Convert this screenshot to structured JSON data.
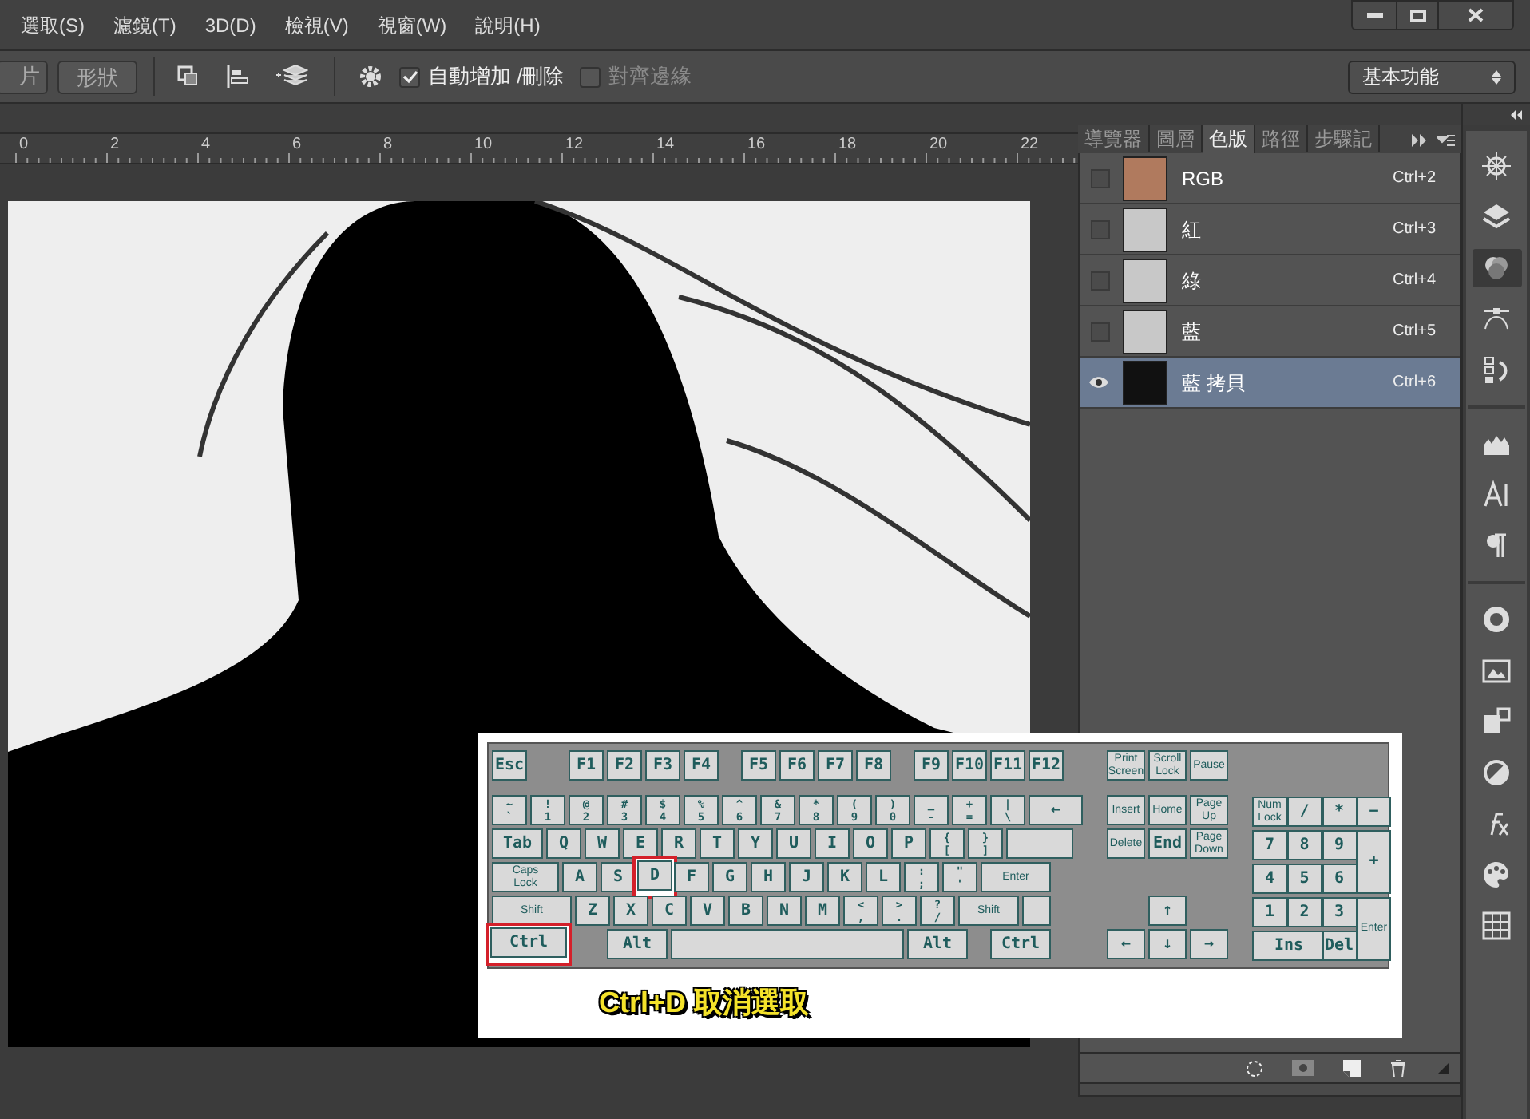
{
  "menu": [
    "選取(S)",
    "濾鏡(T)",
    "3D(D)",
    "檢視(V)",
    "視窗(W)",
    "說明(H)"
  ],
  "options_bar": {
    "buttons": [
      "片",
      "形狀"
    ],
    "auto_add_delete": {
      "label": "自動增加 /刪除",
      "checked": true
    },
    "snap_edges": {
      "label": "對齊邊緣",
      "checked": false,
      "disabled": true
    },
    "workspace": "基本功能"
  },
  "ruler": [
    "0",
    "2",
    "4",
    "6",
    "8",
    "10",
    "12",
    "14",
    "16",
    "18",
    "20",
    "22"
  ],
  "channels_panel": {
    "tabs": [
      {
        "label": "導覽器",
        "selected": false
      },
      {
        "label": "圖層",
        "selected": false
      },
      {
        "label": "色版",
        "selected": true
      },
      {
        "label": "路徑",
        "selected": false
      },
      {
        "label": "步驟記",
        "selected": false
      }
    ],
    "channels": [
      {
        "name": "RGB",
        "shortcut": "Ctrl+2",
        "visible": false,
        "selected": false,
        "kind": "color"
      },
      {
        "name": "紅",
        "shortcut": "Ctrl+3",
        "visible": false,
        "selected": false,
        "kind": "gray"
      },
      {
        "name": "綠",
        "shortcut": "Ctrl+4",
        "visible": false,
        "selected": false,
        "kind": "gray"
      },
      {
        "name": "藍",
        "shortcut": "Ctrl+5",
        "visible": false,
        "selected": false,
        "kind": "gray"
      },
      {
        "name": "藍 拷貝",
        "shortcut": "Ctrl+6",
        "visible": true,
        "selected": true,
        "kind": "mask"
      }
    ]
  },
  "dock": [
    {
      "selected": false
    },
    {
      "selected": false
    },
    {
      "selected": true
    },
    {
      "selected": false
    },
    {
      "selected": false
    },
    {
      "selected": false
    },
    {
      "selected": false
    },
    {
      "selected": false
    },
    {
      "selected": false
    },
    {
      "selected": false
    },
    {
      "selected": false
    },
    {
      "selected": false
    },
    {
      "selected": false
    },
    {
      "selected": false
    },
    {
      "selected": false
    }
  ],
  "keyboard_image": {
    "main_rows": [
      [
        {
          "label": "Esc",
          "kind": "key",
          "highlighted": false
        },
        {
          "kind": "gap"
        },
        {
          "label": "F1",
          "kind": "key",
          "highlighted": false
        },
        {
          "label": "F2",
          "kind": "key",
          "highlighted": false
        },
        {
          "label": "F3",
          "kind": "key",
          "highlighted": false
        },
        {
          "label": "F4",
          "kind": "key",
          "highlighted": false
        },
        {
          "kind": "split"
        },
        {
          "label": "F5",
          "kind": "key",
          "highlighted": false
        },
        {
          "label": "F6",
          "kind": "key",
          "highlighted": false
        },
        {
          "label": "F7",
          "kind": "key",
          "highlighted": false
        },
        {
          "label": "F8",
          "kind": "key",
          "highlighted": false
        },
        {
          "kind": "split"
        },
        {
          "label": "F9",
          "kind": "key",
          "highlighted": false
        },
        {
          "label": "F10",
          "kind": "key",
          "highlighted": false
        },
        {
          "label": "F11",
          "kind": "key",
          "highlighted": false
        },
        {
          "label": "F12",
          "kind": "key",
          "highlighted": false
        }
      ],
      [
        {
          "label": "~\n`",
          "kind": "key",
          "highlighted": false
        },
        {
          "label": "!\n1",
          "kind": "key",
          "highlighted": false
        },
        {
          "label": "@\n2",
          "kind": "key",
          "highlighted": false
        },
        {
          "label": "#\n3",
          "kind": "key",
          "highlighted": false
        },
        {
          "label": "$\n4",
          "kind": "key",
          "highlighted": false
        },
        {
          "label": "%\n5",
          "kind": "key",
          "highlighted": false
        },
        {
          "label": "^\n6",
          "kind": "key",
          "highlighted": false
        },
        {
          "label": "&\n7",
          "kind": "key",
          "highlighted": false
        },
        {
          "label": "*\n8",
          "kind": "key",
          "highlighted": false
        },
        {
          "label": "(\n9",
          "kind": "key",
          "highlighted": false
        },
        {
          "label": ")\n0",
          "kind": "key",
          "highlighted": false
        },
        {
          "label": "_\n-",
          "kind": "key",
          "highlighted": false
        },
        {
          "label": "+\n=",
          "kind": "key",
          "highlighted": false
        },
        {
          "label": "|\n\\",
          "kind": "key",
          "highlighted": false
        },
        {
          "label": "←",
          "kind": "back",
          "highlighted": false
        }
      ],
      [
        {
          "label": "Tab",
          "kind": "tab",
          "highlighted": false
        },
        {
          "label": "Q",
          "kind": "key",
          "highlighted": false
        },
        {
          "label": "W",
          "kind": "key",
          "highlighted": false
        },
        {
          "label": "E",
          "kind": "key",
          "highlighted": false
        },
        {
          "label": "R",
          "kind": "key",
          "highlighted": false
        },
        {
          "label": "T",
          "kind": "key",
          "highlighted": false
        },
        {
          "label": "Y",
          "kind": "key",
          "highlighted": false
        },
        {
          "label": "U",
          "kind": "key",
          "highlighted": false
        },
        {
          "label": "I",
          "kind": "key",
          "highlighted": false
        },
        {
          "label": "O",
          "kind": "key",
          "highlighted": false
        },
        {
          "label": "P",
          "kind": "key",
          "highlighted": false
        },
        {
          "label": "{\n[",
          "kind": "key",
          "highlighted": false
        },
        {
          "label": "}\n]",
          "kind": "key",
          "highlighted": false
        },
        {
          "kind": "entertop",
          "highlighted": false
        }
      ],
      [
        {
          "label": "Caps\nLock",
          "kind": "caps",
          "highlighted": false
        },
        {
          "label": "A",
          "kind": "key",
          "highlighted": false
        },
        {
          "label": "S",
          "kind": "key",
          "highlighted": false
        },
        {
          "label": "D",
          "kind": "key",
          "highlighted": true
        },
        {
          "label": "F",
          "kind": "key",
          "highlighted": false
        },
        {
          "label": "G",
          "kind": "key",
          "highlighted": false
        },
        {
          "label": "H",
          "kind": "key",
          "highlighted": false
        },
        {
          "label": "J",
          "kind": "key",
          "highlighted": false
        },
        {
          "label": "K",
          "kind": "key",
          "highlighted": false
        },
        {
          "label": "L",
          "kind": "key",
          "highlighted": false
        },
        {
          "label": ":\n;",
          "kind": "key",
          "highlighted": false
        },
        {
          "label": "\"\n'",
          "kind": "key",
          "highlighted": false
        },
        {
          "label": "Enter",
          "kind": "enter",
          "highlighted": false
        }
      ],
      [
        {
          "label": "Shift",
          "kind": "shift",
          "highlighted": false
        },
        {
          "label": "Z",
          "kind": "key",
          "highlighted": false
        },
        {
          "label": "X",
          "kind": "key",
          "highlighted": false
        },
        {
          "label": "C",
          "kind": "key",
          "highlighted": false
        },
        {
          "label": "V",
          "kind": "key",
          "highlighted": false
        },
        {
          "label": "B",
          "kind": "key",
          "highlighted": false
        },
        {
          "label": "N",
          "kind": "key",
          "highlighted": false
        },
        {
          "label": "M",
          "kind": "key",
          "highlighted": false
        },
        {
          "label": "<\n,",
          "kind": "key",
          "highlighted": false
        },
        {
          "label": ">\n.",
          "kind": "key",
          "highlighted": false
        },
        {
          "label": "?\n/",
          "kind": "key",
          "highlighted": false
        },
        {
          "label": "Shift",
          "kind": "rshift",
          "highlighted": false
        },
        {
          "kind": "blank",
          "highlighted": false
        }
      ],
      [
        {
          "label": "Ctrl",
          "kind": "ctrl",
          "highlighted": true
        },
        {
          "kind": "gap"
        },
        {
          "label": "Alt",
          "kind": "alt",
          "highlighted": false
        },
        {
          "kind": "space",
          "highlighted": false
        },
        {
          "label": "Alt",
          "kind": "alt",
          "highlighted": false
        },
        {
          "kind": "split"
        },
        {
          "label": "Ctrl",
          "kind": "rctrl",
          "highlighted": false
        }
      ]
    ],
    "nav_keys": [
      {
        "label": "Print\nScreen",
        "kind": "key"
      },
      {
        "label": "Scroll\nLock",
        "kind": "key"
      },
      {
        "label": "Pause",
        "kind": "key"
      },
      {
        "label": "Insert",
        "kind": "key"
      },
      {
        "label": "Home",
        "kind": "key"
      },
      {
        "label": "Page\nUp",
        "kind": "key"
      },
      {
        "label": "Delete",
        "kind": "key"
      },
      {
        "label": "End",
        "kind": "key"
      },
      {
        "label": "Page\nDown",
        "kind": "key"
      },
      {
        "kind": "gap"
      },
      {
        "kind": "gap"
      },
      {
        "kind": "gap"
      },
      {
        "kind": "gap"
      },
      {
        "label": "↑",
        "kind": "key"
      },
      {
        "kind": "gap"
      },
      {
        "label": "←",
        "kind": "key"
      },
      {
        "label": "↓",
        "kind": "key"
      },
      {
        "label": "→",
        "kind": "key"
      }
    ],
    "numpad_keys": [
      {
        "label": "Num\nLock",
        "kind": "key"
      },
      {
        "label": "/",
        "kind": "key"
      },
      {
        "label": "*",
        "kind": "key"
      },
      {
        "label": "−",
        "kind": "key"
      },
      {
        "label": "7",
        "kind": "key"
      },
      {
        "label": "8",
        "kind": "key"
      },
      {
        "label": "9",
        "kind": "key"
      },
      {
        "label": "+",
        "kind": "tall"
      },
      {
        "label": "4",
        "kind": "key"
      },
      {
        "label": "5",
        "kind": "key"
      },
      {
        "label": "6",
        "kind": "key"
      },
      {
        "label": "1",
        "kind": "key"
      },
      {
        "label": "2",
        "kind": "key"
      },
      {
        "label": "3",
        "kind": "key"
      },
      {
        "label": "Enter",
        "kind": "tall"
      },
      {
        "label": "Ins",
        "kind": "wide"
      },
      {
        "label": "Del",
        "kind": "key"
      }
    ],
    "caption": "Ctrl+D 取消選取"
  }
}
